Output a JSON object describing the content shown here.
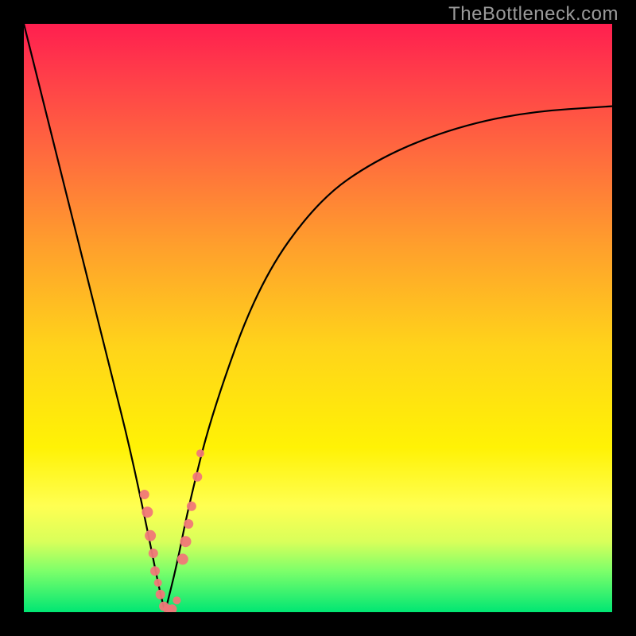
{
  "watermark": "TheBottleneck.com",
  "chart_data": {
    "type": "line",
    "title": "",
    "xlabel": "",
    "ylabel": "",
    "xlim": [
      0,
      100
    ],
    "ylim": [
      0,
      100
    ],
    "minimum_x_percent": 24,
    "curve_left": {
      "x_percent": [
        0,
        3,
        6,
        9,
        12,
        15,
        18,
        21,
        23,
        24
      ],
      "y_percent": [
        100,
        88,
        76,
        64,
        52,
        40,
        28,
        14,
        4,
        0
      ]
    },
    "curve_right": {
      "x_percent": [
        24,
        26,
        28,
        32,
        40,
        50,
        60,
        72,
        85,
        100
      ],
      "y_percent": [
        0,
        8,
        18,
        34,
        56,
        70,
        77,
        82,
        85,
        86
      ]
    },
    "points": [
      {
        "x_percent": 20.5,
        "y_percent": 20,
        "r": 6
      },
      {
        "x_percent": 21.0,
        "y_percent": 17,
        "r": 7
      },
      {
        "x_percent": 21.5,
        "y_percent": 13,
        "r": 7
      },
      {
        "x_percent": 22.0,
        "y_percent": 10,
        "r": 6
      },
      {
        "x_percent": 22.3,
        "y_percent": 7,
        "r": 6
      },
      {
        "x_percent": 22.8,
        "y_percent": 5,
        "r": 5
      },
      {
        "x_percent": 23.2,
        "y_percent": 3,
        "r": 6
      },
      {
        "x_percent": 23.8,
        "y_percent": 1,
        "r": 6
      },
      {
        "x_percent": 24.5,
        "y_percent": 0.5,
        "r": 6
      },
      {
        "x_percent": 25.2,
        "y_percent": 0.5,
        "r": 6
      },
      {
        "x_percent": 26.0,
        "y_percent": 2,
        "r": 5
      },
      {
        "x_percent": 27.0,
        "y_percent": 9,
        "r": 7
      },
      {
        "x_percent": 27.5,
        "y_percent": 12,
        "r": 7
      },
      {
        "x_percent": 28.0,
        "y_percent": 15,
        "r": 6
      },
      {
        "x_percent": 28.5,
        "y_percent": 18,
        "r": 6
      },
      {
        "x_percent": 29.5,
        "y_percent": 23,
        "r": 6
      },
      {
        "x_percent": 30.0,
        "y_percent": 27,
        "r": 5
      }
    ],
    "point_color": "#f07878",
    "curve_color": "#000000"
  }
}
